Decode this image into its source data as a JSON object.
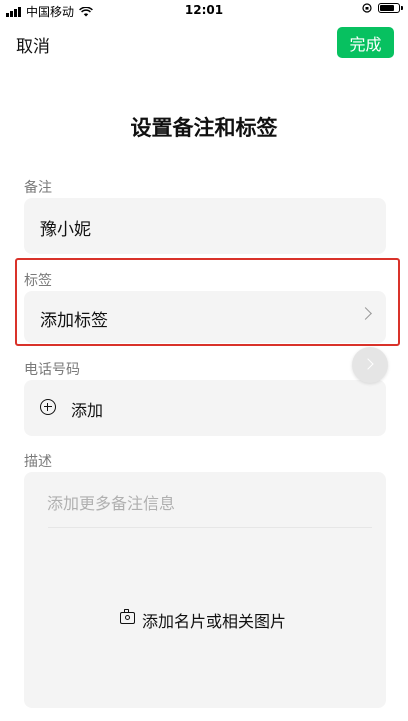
{
  "status_bar": {
    "carrier": "中国移动",
    "time": "12:01",
    "icons": [
      "signal-icon",
      "wifi-icon",
      "orientation-lock-icon",
      "battery-icon"
    ]
  },
  "nav": {
    "cancel_label": "取消",
    "done_label": "完成"
  },
  "title": "设置备注和标签",
  "remark": {
    "label": "备注",
    "value": "豫小妮"
  },
  "tags": {
    "label": "标签",
    "value": "添加标签"
  },
  "phone": {
    "label": "电话号码",
    "add_label": "添加"
  },
  "description": {
    "label": "描述",
    "placeholder": "添加更多备注信息",
    "add_photo_label": "添加名片或相关图片"
  },
  "colors": {
    "accent": "#07c160",
    "highlight": "#d9322a",
    "field_bg": "#f4f4f4"
  }
}
